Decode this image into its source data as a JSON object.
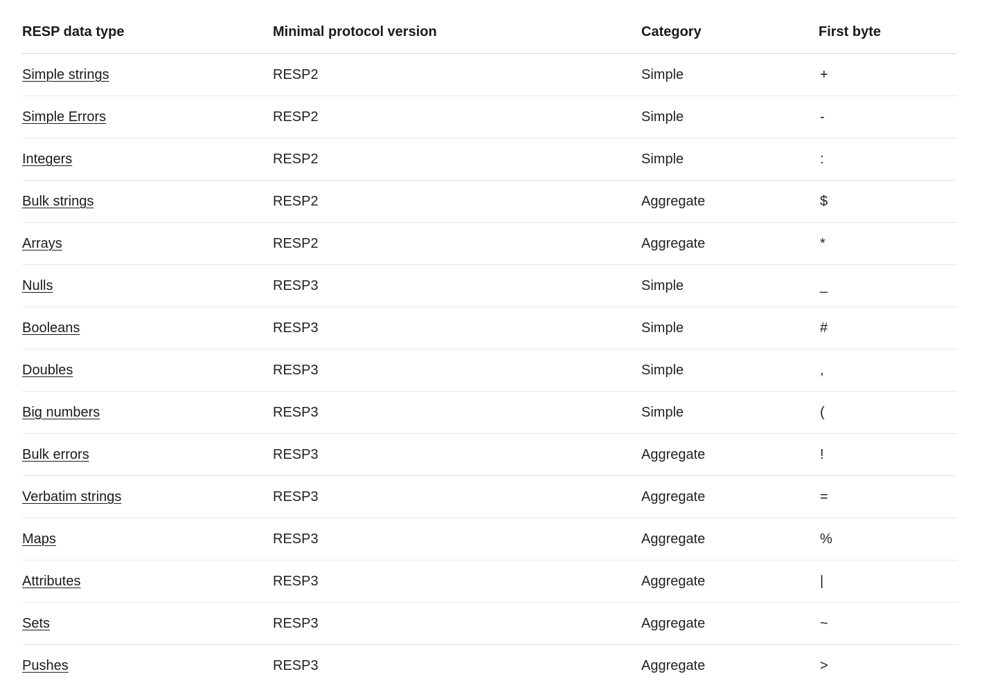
{
  "table": {
    "headers": [
      "RESP data type",
      "Minimal protocol version",
      "Category",
      "First byte"
    ],
    "rows": [
      {
        "type": "Simple strings",
        "version": "RESP2",
        "category": "Simple",
        "first_byte": "+"
      },
      {
        "type": "Simple Errors",
        "version": "RESP2",
        "category": "Simple",
        "first_byte": "-"
      },
      {
        "type": "Integers",
        "version": "RESP2",
        "category": "Simple",
        "first_byte": ":"
      },
      {
        "type": "Bulk strings",
        "version": "RESP2",
        "category": "Aggregate",
        "first_byte": "$"
      },
      {
        "type": "Arrays",
        "version": "RESP2",
        "category": "Aggregate",
        "first_byte": "*"
      },
      {
        "type": "Nulls",
        "version": "RESP3",
        "category": "Simple",
        "first_byte": "_"
      },
      {
        "type": "Booleans",
        "version": "RESP3",
        "category": "Simple",
        "first_byte": "#"
      },
      {
        "type": "Doubles",
        "version": "RESP3",
        "category": "Simple",
        "first_byte": ","
      },
      {
        "type": "Big numbers",
        "version": "RESP3",
        "category": "Simple",
        "first_byte": "("
      },
      {
        "type": "Bulk errors",
        "version": "RESP3",
        "category": "Aggregate",
        "first_byte": "!"
      },
      {
        "type": "Verbatim strings",
        "version": "RESP3",
        "category": "Aggregate",
        "first_byte": "="
      },
      {
        "type": "Maps",
        "version": "RESP3",
        "category": "Aggregate",
        "first_byte": "%"
      },
      {
        "type": "Attributes",
        "version": "RESP3",
        "category": "Aggregate",
        "first_byte": "|"
      },
      {
        "type": "Sets",
        "version": "RESP3",
        "category": "Aggregate",
        "first_byte": "~"
      },
      {
        "type": "Pushes",
        "version": "RESP3",
        "category": "Aggregate",
        "first_byte": ">"
      }
    ]
  }
}
